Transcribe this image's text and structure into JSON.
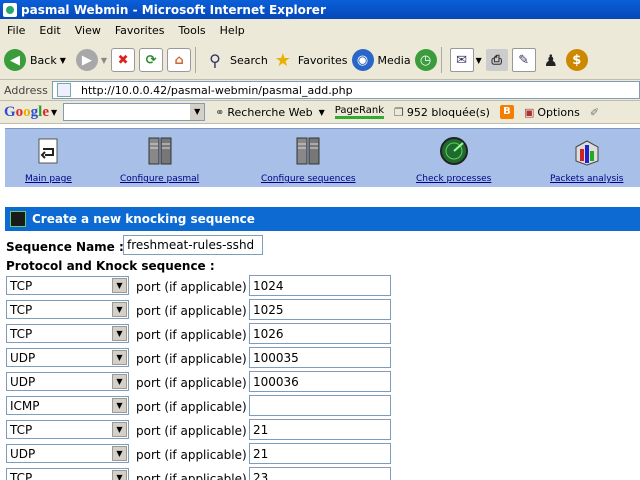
{
  "window": {
    "title": "pasmal Webmin - Microsoft Internet Explorer"
  },
  "menu": [
    "File",
    "Edit",
    "View",
    "Favorites",
    "Tools",
    "Help"
  ],
  "toolbar": {
    "back": "Back",
    "search": "Search",
    "favorites": "Favorites",
    "media": "Media"
  },
  "address": {
    "label": "Address",
    "url": "http://10.0.0.42/pasmal-webmin/pasmal_add.php"
  },
  "googlebar": {
    "logo": "Google",
    "web_search": "Recherche Web",
    "pagerank": "PageRank",
    "blocked": "952 bloquée(s)",
    "options": "Options"
  },
  "nav": [
    {
      "label": "Main page",
      "icon": "main-page-icon"
    },
    {
      "label": "Configure pasmal",
      "icon": "server-icon"
    },
    {
      "label": "Configure sequences",
      "icon": "server-icon"
    },
    {
      "label": "Check processes",
      "icon": "radar-icon"
    },
    {
      "label": "Packets analysis",
      "icon": "packets-icon"
    }
  ],
  "section": {
    "title": "Create a new knocking sequence"
  },
  "form": {
    "sequence_name_label": "Sequence Name :",
    "sequence_name_value": "freshmeat-rules-sshd",
    "protocol_label": "Protocol and Knock sequence :",
    "port_label": "port (if applicable) :",
    "rows": [
      {
        "protocol": "TCP",
        "port": "1024"
      },
      {
        "protocol": "TCP",
        "port": "1025"
      },
      {
        "protocol": "TCP",
        "port": "1026"
      },
      {
        "protocol": "UDP",
        "port": "100035"
      },
      {
        "protocol": "UDP",
        "port": "100036"
      },
      {
        "protocol": "ICMP",
        "port": ""
      },
      {
        "protocol": "TCP",
        "port": "21"
      },
      {
        "protocol": "UDP",
        "port": "21"
      },
      {
        "protocol": "TCP",
        "port": "23"
      }
    ]
  }
}
